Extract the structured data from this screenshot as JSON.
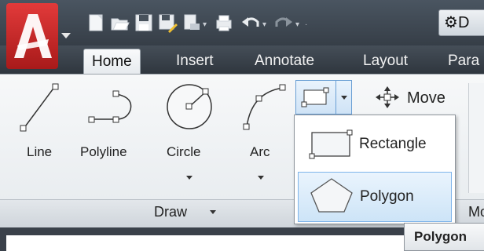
{
  "quick_access": {
    "workspace_label": "D",
    "icons": [
      "new-icon",
      "open-icon",
      "save-icon",
      "save-as-icon",
      "publish-icon",
      "plot-icon",
      "undo-icon",
      "redo-icon",
      "workspace-gear-icon"
    ]
  },
  "tabs": [
    {
      "label": "Home",
      "active": true
    },
    {
      "label": "Insert",
      "active": false
    },
    {
      "label": "Annotate",
      "active": false
    },
    {
      "label": "Layout",
      "active": false
    },
    {
      "label": "Para",
      "active": false
    }
  ],
  "draw_panel": {
    "title": "Draw",
    "tools": [
      {
        "label": "Line",
        "icon": "line-icon"
      },
      {
        "label": "Polyline",
        "icon": "polyline-icon"
      },
      {
        "label": "Circle",
        "icon": "circle-icon"
      },
      {
        "label": "Arc",
        "icon": "arc-icon"
      }
    ]
  },
  "modify_panel": {
    "move_label": "Move",
    "partial_text": "h",
    "title_partial": "Mo"
  },
  "rectangle_dropdown": {
    "items": [
      {
        "label": "Rectangle",
        "icon": "rectangle-icon",
        "highlighted": false
      },
      {
        "label": "Polygon",
        "icon": "polygon-icon",
        "highlighted": true
      }
    ]
  },
  "tooltip": {
    "text": "Polygon"
  },
  "colors": {
    "accent_red": "#c62828",
    "highlight_blue": "#cde4f7",
    "highlight_border": "#7eb4ea",
    "dark_bar": "#363e47"
  }
}
